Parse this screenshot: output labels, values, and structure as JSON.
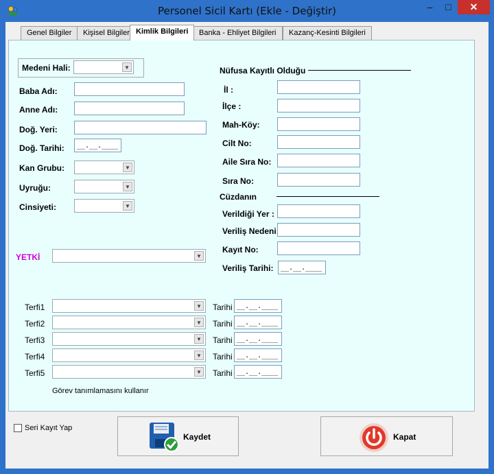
{
  "window": {
    "title": "Personel Sicil Kartı (Ekle - Değiştir)",
    "min_label": "–",
    "max_label": "□",
    "close_label": "✕"
  },
  "tabs": [
    {
      "label": "Genel Bilgiler"
    },
    {
      "label": "Kişisel Bilgiler"
    },
    {
      "label": "Kimlik Bilgileri"
    },
    {
      "label": "Banka - Ehliyet Bilgileri"
    },
    {
      "label": "Kazanç-Kesinti Bilgileri"
    }
  ],
  "active_tab": "Kimlik Bilgileri",
  "left": {
    "medeni_hali": {
      "label": "Medeni Hali:",
      "value": ""
    },
    "baba_adi": {
      "label": "Baba Adı:",
      "value": ""
    },
    "anne_adi": {
      "label": "Anne Adı:",
      "value": ""
    },
    "dog_yeri": {
      "label": "Doğ. Yeri:",
      "value": ""
    },
    "dog_tarihi": {
      "label": "Doğ. Tarihi:",
      "mask": "__.__.____"
    },
    "kan_grubu": {
      "label": "Kan Grubu:",
      "value": ""
    },
    "uyrugu": {
      "label": "Uyruğu:",
      "value": ""
    },
    "cinsiyeti": {
      "label": "Cinsiyeti:",
      "value": ""
    },
    "yetki": {
      "label": "YETKİ",
      "value": ""
    }
  },
  "nufus": {
    "heading": "Nüfusa Kayıtlı Olduğu",
    "il": {
      "label": "İl :",
      "value": ""
    },
    "ilce": {
      "label": "İlçe :",
      "value": ""
    },
    "mah_koy": {
      "label": "Mah-Köy:",
      "value": ""
    },
    "cilt_no": {
      "label": "Cilt No:",
      "value": ""
    },
    "aile_sira_no": {
      "label": "Aile Sıra No:",
      "value": ""
    },
    "sira_no": {
      "label": "Sıra No:",
      "value": ""
    }
  },
  "cuzdan": {
    "heading": "Cüzdanın",
    "verildigi_yer": {
      "label": "Verildiği Yer :",
      "value": ""
    },
    "verilis_nedeni": {
      "label": "Veriliş Nedeni:",
      "value": ""
    },
    "kayit_no": {
      "label": "Kayıt No:",
      "value": ""
    },
    "verilis_tarihi": {
      "label": "Veriliş Tarihi:",
      "mask": "__.__.____"
    }
  },
  "terfi": [
    {
      "label": "Terfi1",
      "value": "",
      "date_label": "Tarihi :",
      "date_mask": "__.__.____"
    },
    {
      "label": "Terfi2",
      "value": "",
      "date_label": "Tarihi :",
      "date_mask": "__.__.____"
    },
    {
      "label": "Terfi3",
      "value": "",
      "date_label": "Tarihi :",
      "date_mask": "__.__.____"
    },
    {
      "label": "Terfi4",
      "value": "",
      "date_label": "Tarihi :",
      "date_mask": "__.__.____"
    },
    {
      "label": "Terfi5",
      "value": "",
      "date_label": "Tarihi :",
      "date_mask": "__.__.____"
    }
  ],
  "gorev_note": "Görev tanımlamasını kullanır",
  "footer": {
    "seri_kayit_label": "Seri Kayıt Yap",
    "save_label": "Kaydet",
    "close_label": "Kapat"
  },
  "colors": {
    "panel_bg": "#e9fffe",
    "yetki_label": "#d400d4",
    "window_frame": "#2f72c9",
    "close_button": "#c7302c"
  }
}
